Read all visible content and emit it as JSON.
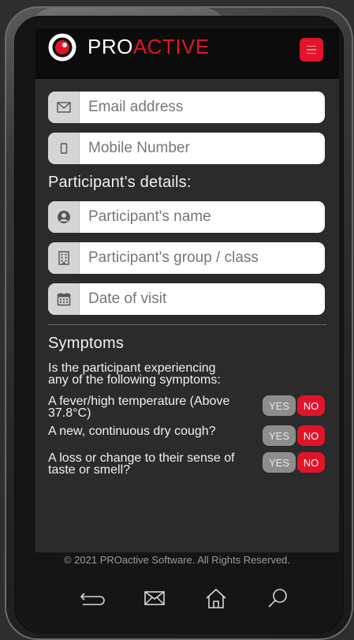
{
  "brand": {
    "pro": "PRO",
    "active": "ACTIVE"
  },
  "colors": {
    "accent": "#e0142a",
    "header_bg": "#0c0c0c",
    "screen_bg": "#2b2b2b"
  },
  "contact": {
    "email_placeholder": "Email address",
    "mobile_placeholder": "Mobile Number"
  },
  "participant": {
    "title": "Participant's details:",
    "name_placeholder": "Participant's name",
    "group_placeholder": "Participant's group / class",
    "date_placeholder": "Date of visit"
  },
  "symptoms": {
    "title": "Symptoms",
    "intro": "Is the participant experiencing any of the following symptoms:",
    "yes_label": "YES",
    "no_label": "NO",
    "items": [
      {
        "label": "A fever/high temperature (Above 37.8°C)"
      },
      {
        "label": "A new, continuous dry cough?"
      },
      {
        "label": "A loss or change to their sense of taste or smell?"
      }
    ]
  },
  "footer": {
    "copyright": "© 2021 PROactive Software. All Rights Reserved."
  },
  "icons": {
    "email": "envelope-icon",
    "mobile": "mobile-icon",
    "user": "user-circle-icon",
    "group": "building-icon",
    "date": "calendar-icon",
    "nav_back": "back-icon",
    "nav_mail": "mail-icon",
    "nav_home": "home-icon",
    "nav_search": "search-icon"
  }
}
